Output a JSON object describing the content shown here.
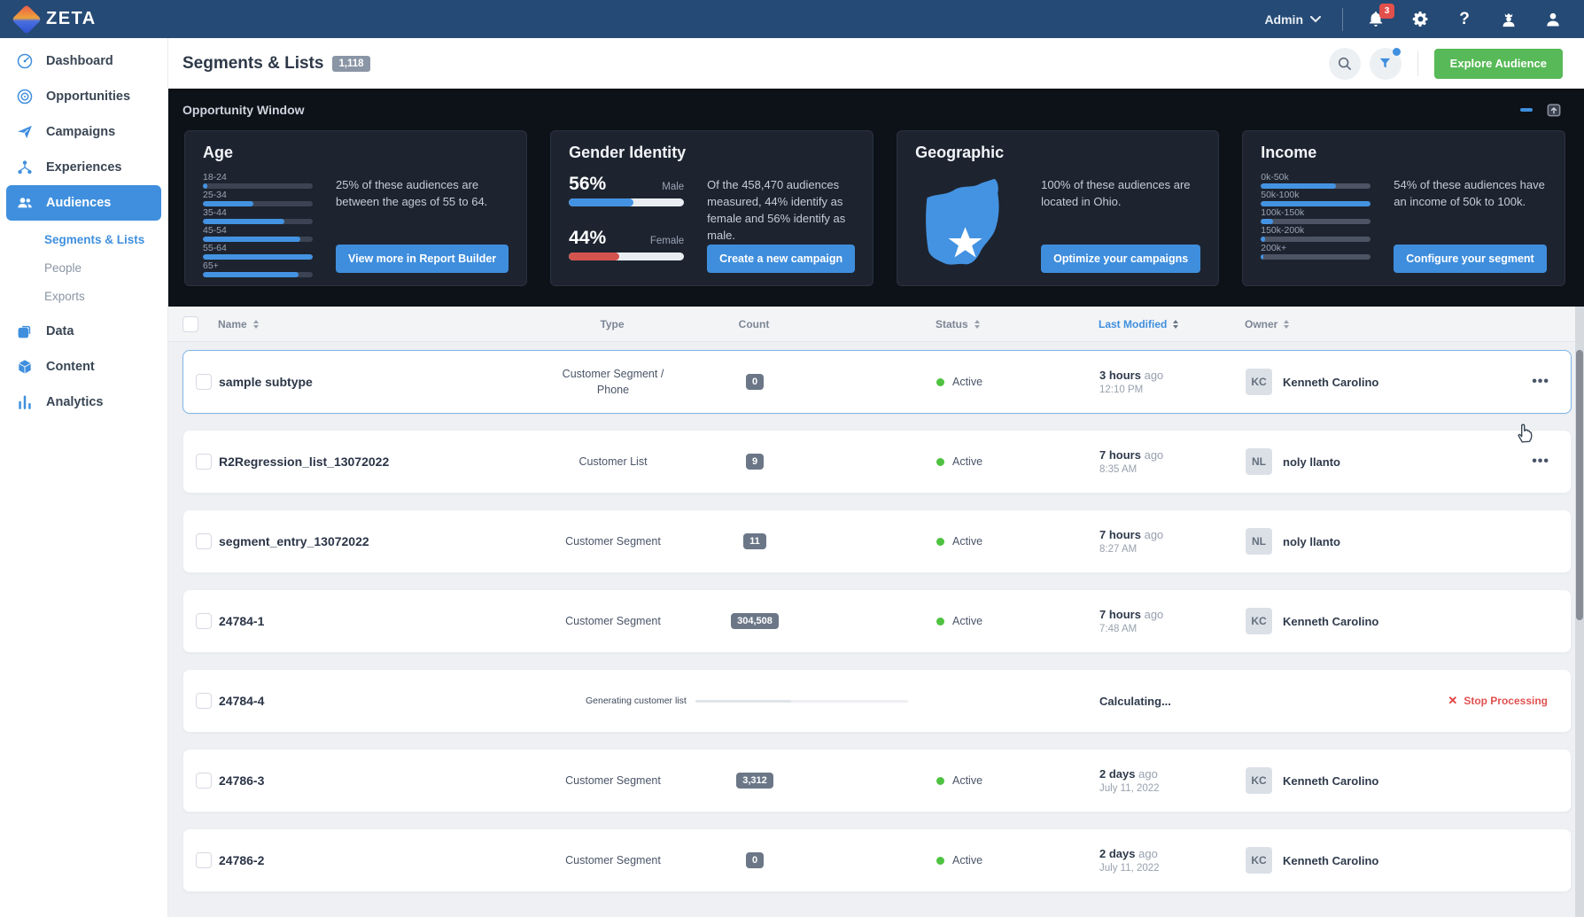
{
  "topbar": {
    "brand": "ZETA",
    "admin_label": "Admin",
    "notification_count": "3"
  },
  "sidebar": {
    "items": [
      {
        "label": "Dashboard"
      },
      {
        "label": "Opportunities"
      },
      {
        "label": "Campaigns"
      },
      {
        "label": "Experiences"
      },
      {
        "label": "Audiences"
      },
      {
        "label": "Data"
      },
      {
        "label": "Content"
      },
      {
        "label": "Analytics"
      }
    ],
    "sub_items": [
      {
        "label": "Segments & Lists"
      },
      {
        "label": "People"
      },
      {
        "label": "Exports"
      }
    ]
  },
  "header": {
    "title": "Segments & Lists",
    "count_badge": "1,118",
    "explore_button": "Explore Audience"
  },
  "opportunity": {
    "title": "Opportunity Window",
    "age": {
      "title": "Age",
      "labels": [
        "18-24",
        "25-34",
        "35-44",
        "45-54",
        "55-64",
        "65+"
      ],
      "values": [
        4,
        46,
        74,
        89,
        100,
        87
      ],
      "description": "25% of these audiences are between the ages of 55 to 64.",
      "button": "View more in Report Builder"
    },
    "gender": {
      "title": "Gender Identity",
      "male_pct": "56%",
      "male_label": "Male",
      "male_value": 56,
      "female_pct": "44%",
      "female_label": "Female",
      "female_value": 44,
      "description": "Of the 458,470 audiences measured, 44% identify as female and 56% identify as male.",
      "button": "Create a new campaign"
    },
    "geographic": {
      "title": "Geographic",
      "description": "100% of these audiences are located in Ohio.",
      "button": "Optimize your campaigns"
    },
    "income": {
      "title": "Income",
      "labels": [
        "0k-50k",
        "50k-100k",
        "100k-150k",
        "150k-200k",
        "200k+"
      ],
      "values": [
        68,
        100,
        11,
        4,
        2
      ],
      "description": "54% of these audiences have an income of 50k to 100k.",
      "button": "Configure your segment"
    }
  },
  "table": {
    "columns": {
      "name": "Name",
      "type": "Type",
      "count": "Count",
      "status": "Status",
      "last_modified": "Last Modified",
      "owner": "Owner"
    },
    "rows": [
      {
        "name": "sample subtype",
        "type": "Customer Segment / Phone",
        "count": "0",
        "status": "Active",
        "modified": "3 hours",
        "modified_suffix": "ago",
        "modified_detail": "12:10 PM",
        "owner_initials": "KC",
        "owner": "Kenneth Carolino"
      },
      {
        "name": "R2Regression_list_13072022",
        "type": "Customer List",
        "count": "9",
        "status": "Active",
        "modified": "7 hours",
        "modified_suffix": "ago",
        "modified_detail": "8:35 AM",
        "owner_initials": "NL",
        "owner": "noly llanto"
      },
      {
        "name": "segment_entry_13072022",
        "type": "Customer Segment",
        "count": "11",
        "status": "Active",
        "modified": "7 hours",
        "modified_suffix": "ago",
        "modified_detail": "8:27 AM",
        "owner_initials": "NL",
        "owner": "noly llanto"
      },
      {
        "name": "24784-1",
        "type": "Customer Segment",
        "count": "304,508",
        "status": "Active",
        "modified": "7 hours",
        "modified_suffix": "ago",
        "modified_detail": "7:48 AM",
        "owner_initials": "KC",
        "owner": "Kenneth Carolino"
      },
      {
        "name": "24784-4",
        "progress_label": "Generating customer list",
        "progress_value": 45,
        "modified": "Calculating...",
        "stop_label": "Stop Processing"
      },
      {
        "name": "24786-3",
        "type": "Customer Segment",
        "count": "3,312",
        "status": "Active",
        "modified": "2 days",
        "modified_suffix": "ago",
        "modified_detail": "July 11, 2022",
        "owner_initials": "KC",
        "owner": "Kenneth Carolino"
      },
      {
        "name": "24786-2",
        "type": "Customer Segment",
        "count": "0",
        "status": "Active",
        "modified": "2 days",
        "modified_suffix": "ago",
        "modified_detail": "July 11, 2022",
        "owner_initials": "KC",
        "owner": "Kenneth Carolino"
      }
    ]
  }
}
